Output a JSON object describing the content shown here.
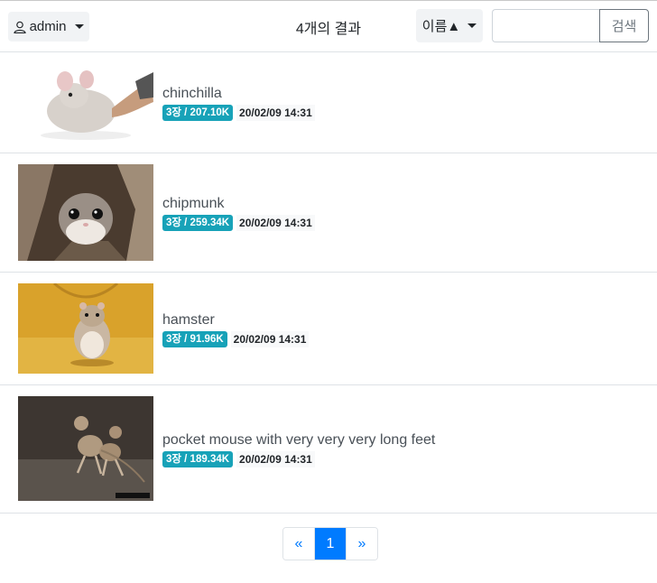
{
  "header": {
    "user_label": "admin",
    "result_count": "4개의 결과",
    "sort_label": "이름▲",
    "search_placeholder": "",
    "search_button": "검색"
  },
  "items": [
    {
      "title": "chinchilla",
      "badge": "3장 / 207.10K",
      "date": "20/02/09 14:31"
    },
    {
      "title": "chipmunk",
      "badge": "3장 / 259.34K",
      "date": "20/02/09 14:31"
    },
    {
      "title": "hamster",
      "badge": "3장 / 91.96K",
      "date": "20/02/09 14:31"
    },
    {
      "title": "pocket mouse with very very very long feet",
      "badge": "3장 / 189.34K",
      "date": "20/02/09 14:31"
    }
  ],
  "pagination": {
    "prev": "«",
    "current": "1",
    "next": "»"
  },
  "colors": {
    "badge": "#17a2b8",
    "active_page": "#007bff"
  }
}
